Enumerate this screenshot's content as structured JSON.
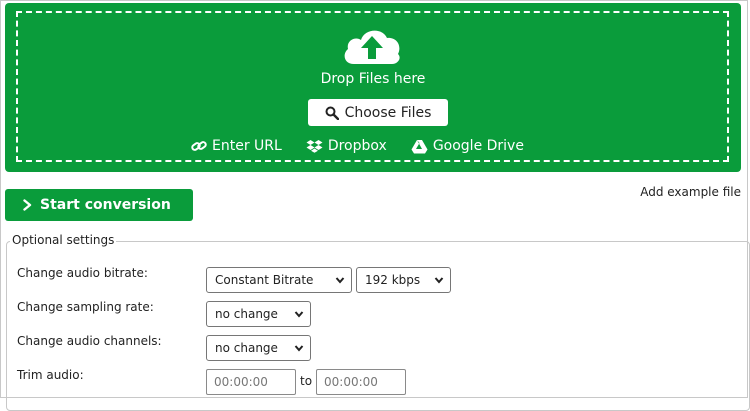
{
  "upload": {
    "drop_text": "Drop Files here",
    "choose_label": "Choose Files",
    "sources": [
      "Enter URL",
      "Dropbox",
      "Google Drive"
    ]
  },
  "actions": {
    "start_label": "Start conversion",
    "example_label": "Add example file"
  },
  "settings": {
    "legend": "Optional settings",
    "bitrate_label": "Change audio bitrate:",
    "bitrate_mode": "Constant Bitrate",
    "bitrate_value": "192 kbps",
    "sampling_label": "Change sampling rate:",
    "sampling_value": "no change",
    "channels_label": "Change audio channels:",
    "channels_value": "no change",
    "trim_label": "Trim audio:",
    "trim_from": "00:00:00",
    "trim_to_text": "to",
    "trim_to": "00:00:00"
  },
  "colors": {
    "brand_green": "#0a9c3b"
  },
  "icons": {
    "upload": "cloud-upload-icon",
    "search": "search-icon",
    "link": "link-icon",
    "dropbox": "dropbox-icon",
    "drive": "google-drive-icon",
    "arrow": "chevron-right-icon",
    "select": "chevron-down-icon"
  }
}
